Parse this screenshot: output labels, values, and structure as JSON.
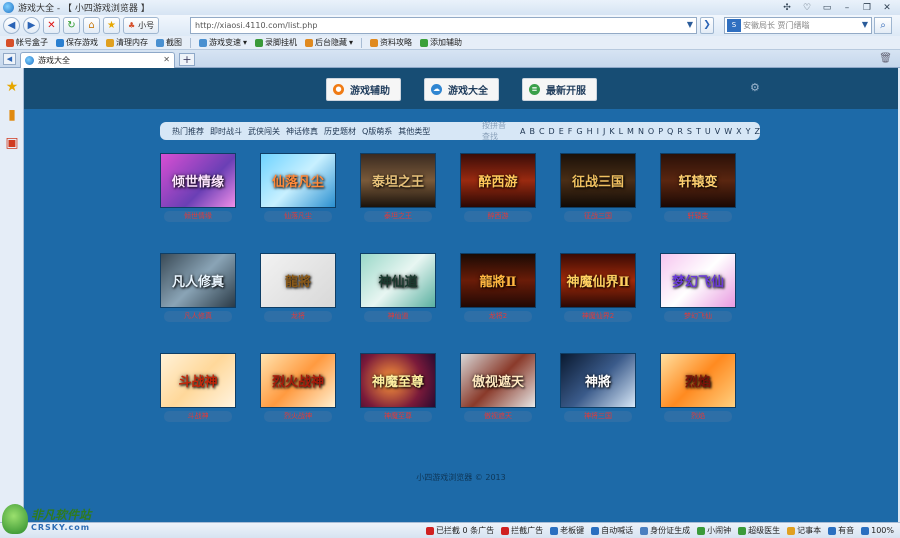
{
  "window": {
    "title": "游戏大全 - 【 小四游戏浏览器 】",
    "controls": [
      "✣",
      "♡",
      "▭",
      "–",
      "❐",
      "✕"
    ]
  },
  "nav": {
    "small_label": "小号",
    "url": "http://xiaosi.4110.com/list.php",
    "search_placeholder": "安徽局长 贾门缙嗡"
  },
  "bookmarks": [
    {
      "label": "帐号盒子",
      "color": "#d64f2a"
    },
    {
      "label": "保存游戏",
      "color": "#2b7fd0"
    },
    {
      "label": "清理内存",
      "color": "#e0a020"
    },
    {
      "label": "截图",
      "color": "#4a90d0"
    },
    {
      "label": "游戏变速",
      "color": "#4a90d0"
    },
    {
      "label": "录脚挂机",
      "color": "#3a9a3a"
    },
    {
      "label": "后台隐藏",
      "color": "#e08a20"
    },
    {
      "label": "资料攻略",
      "color": "#e08a20"
    },
    {
      "label": "添加辅助",
      "color": "#3aa03a"
    }
  ],
  "tabs": [
    {
      "label": "游戏大全"
    }
  ],
  "page": {
    "main_tabs": [
      {
        "label": "游戏辅助",
        "color": "#f07b14"
      },
      {
        "label": "游戏大全",
        "color": "#2f85d1"
      },
      {
        "label": "最新开服",
        "color": "#3aa04a"
      }
    ],
    "categories": [
      "热门推荐",
      "即时战斗",
      "武侠闯关",
      "神话修真",
      "历史题材",
      "Q版萌系",
      "其他类型"
    ],
    "pinyin_label": "按拼音查找",
    "letters": [
      "A",
      "B",
      "C",
      "D",
      "E",
      "F",
      "G",
      "H",
      "I",
      "J",
      "K",
      "L",
      "M",
      "N",
      "O",
      "P",
      "Q",
      "R",
      "S",
      "T",
      "U",
      "V",
      "W",
      "X",
      "Y",
      "Z"
    ],
    "games": [
      {
        "name": "倾世情缘",
        "title": "倾世情缘",
        "bg": "linear-gradient(135deg,#d94fd3,#6a3fb5 60%,#f08fe8)",
        "fg": "#ffe6ff"
      },
      {
        "name": "仙落凡尘",
        "title": "仙落凡尘",
        "bg": "linear-gradient(135deg,#6fd3ff,#c8f0ff 50%,#2a8fd0)",
        "fg": "#ff8a3a"
      },
      {
        "name": "泰坦之王",
        "title": "泰坦之王",
        "bg": "linear-gradient(180deg,#3a2a20,#7a5a3a 50%,#1a120c)",
        "fg": "#e8c27a"
      },
      {
        "name": "醉西游",
        "title": "醉西游",
        "bg": "linear-gradient(180deg,#3a0c08,#9a2a10 50%,#2a0804)",
        "fg": "#ffc85a"
      },
      {
        "name": "征战三国",
        "title": "征战三国",
        "bg": "linear-gradient(180deg,#1a1008,#4a2e16 50%,#100a06)",
        "fg": "#f0c060"
      },
      {
        "name": "轩辕变",
        "title": "轩辕变",
        "bg": "linear-gradient(180deg,#2a1008,#5a2610 50%,#1a0804)",
        "fg": "#ffd070"
      },
      {
        "name": "凡人修真",
        "title": "凡人修真",
        "bg": "linear-gradient(135deg,#3a4a56,#8aa4b6 50%,#2a3a46)",
        "fg": "#eaf6ff"
      },
      {
        "name": "龙将",
        "title": "龍將",
        "bg": "linear-gradient(135deg,#f2f2f2,#d8d8d8)",
        "fg": "#8a5a1a"
      },
      {
        "name": "神仙道",
        "title": "神仙道",
        "bg": "linear-gradient(135deg,#9ad8c8,#e8f6f2 50%,#5ab0a0)",
        "fg": "#1a3a2e"
      },
      {
        "name": "龙将2",
        "title": "龍將Ⅱ",
        "bg": "linear-gradient(180deg,#1a0a04,#6a1c08 50%,#200804)",
        "fg": "#ffb640"
      },
      {
        "name": "神魔仙界2",
        "title": "神魔仙界Ⅱ",
        "bg": "linear-gradient(180deg,#3a0a04,#a02a0a 50%,#2a0804)",
        "fg": "#ffd060"
      },
      {
        "name": "梦幻飞仙",
        "title": "梦幻飞仙",
        "bg": "linear-gradient(135deg,#f6c6f0,#ffffff 50%,#e89ae0)",
        "fg": "#6a3ad8"
      },
      {
        "name": "斗战神",
        "title": "斗战神",
        "bg": "linear-gradient(135deg,#fff2d8,#ffd89a 50%,#fff4e0)",
        "fg": "#c2260a"
      },
      {
        "name": "烈火战神",
        "title": "烈火战神",
        "bg": "linear-gradient(135deg,#ffe4b0,#ff9a40 50%,#fff0d0)",
        "fg": "#a81a0a"
      },
      {
        "name": "神魔至尊",
        "title": "神魔至尊",
        "bg": "radial-gradient(circle at 40% 50%,#ff9a3a,#7a1a3a 60%,#2a0a30)",
        "fg": "#fff0a0"
      },
      {
        "name": "傲视遮天",
        "title": "傲视遮天",
        "bg": "linear-gradient(135deg,#d8d8d8,#8a3a2a 50%,#e8e8e8)",
        "fg": "#ffe8c0"
      },
      {
        "name": "神将三国",
        "title": "神將",
        "bg": "linear-gradient(135deg,#0a1a30,#3a5a8a 50%,#d8e8f8)",
        "fg": "#ffffff"
      },
      {
        "name": "烈焰",
        "title": "烈焰",
        "bg": "linear-gradient(135deg,#ffe0a0,#ff8a20 50%,#ffd080)",
        "fg": "#7a1208"
      }
    ],
    "copyright": "小四游戏浏览器 © 2013"
  },
  "status": [
    {
      "label": "已拦截 0 条广告",
      "color": "#d02020"
    },
    {
      "label": "拦截广告",
      "color": "#d02020"
    },
    {
      "label": "老板键",
      "color": "#2a6fc0"
    },
    {
      "label": "自动喊话",
      "color": "#2a6fc0"
    },
    {
      "label": "身份证生成",
      "color": "#4a7fc0"
    },
    {
      "label": "小闹钟",
      "color": "#3a9a3a"
    },
    {
      "label": "超级医生",
      "color": "#3a9a3a"
    },
    {
      "label": "记事本",
      "color": "#e0a020"
    },
    {
      "label": "有音",
      "color": "#2a6fc0"
    },
    {
      "label": "100%",
      "color": "#2a6fc0"
    }
  ],
  "watermark": {
    "cn": "非凡软件站",
    "en": "CRSKY.com"
  }
}
